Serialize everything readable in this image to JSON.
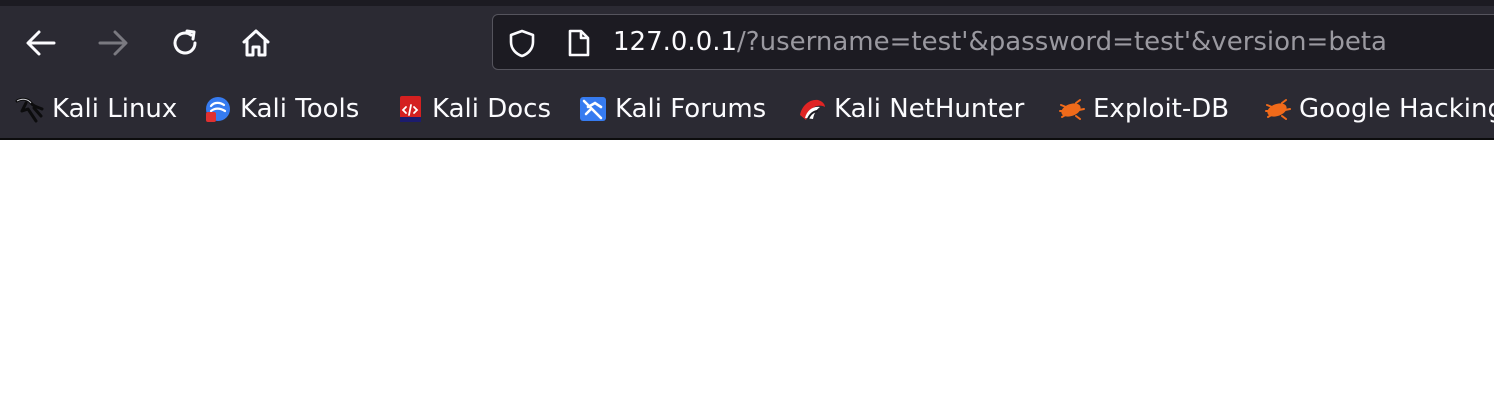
{
  "toolbar": {
    "back_icon": "arrow-left-icon",
    "forward_icon": "arrow-right-icon",
    "reload_icon": "reload-icon",
    "home_icon": "home-icon"
  },
  "urlbar": {
    "host": "127.0.0.1",
    "rest": "/?username=test'&password=test'&version=beta",
    "icons": [
      "shield-icon",
      "page-icon"
    ]
  },
  "bookmarks": [
    {
      "label": "Kali Linux",
      "icon": "kali-dragon-icon"
    },
    {
      "label": "Kali Tools",
      "icon": "kali-tools-icon"
    },
    {
      "label": "Kali Docs",
      "icon": "kali-docs-icon"
    },
    {
      "label": "Kali Forums",
      "icon": "kali-forums-icon"
    },
    {
      "label": "Kali NetHunter",
      "icon": "kali-nethunter-icon"
    },
    {
      "label": "Exploit-DB",
      "icon": "exploit-db-icon"
    },
    {
      "label": "Google Hacking",
      "icon": "exploit-db-icon"
    }
  ],
  "colors": {
    "toolbar_bg": "#2b2a33",
    "urlbar_bg": "#1c1b22",
    "text": "#fbfbfe",
    "dim_text": "#9a99a0",
    "page_bg": "#ffffff"
  }
}
